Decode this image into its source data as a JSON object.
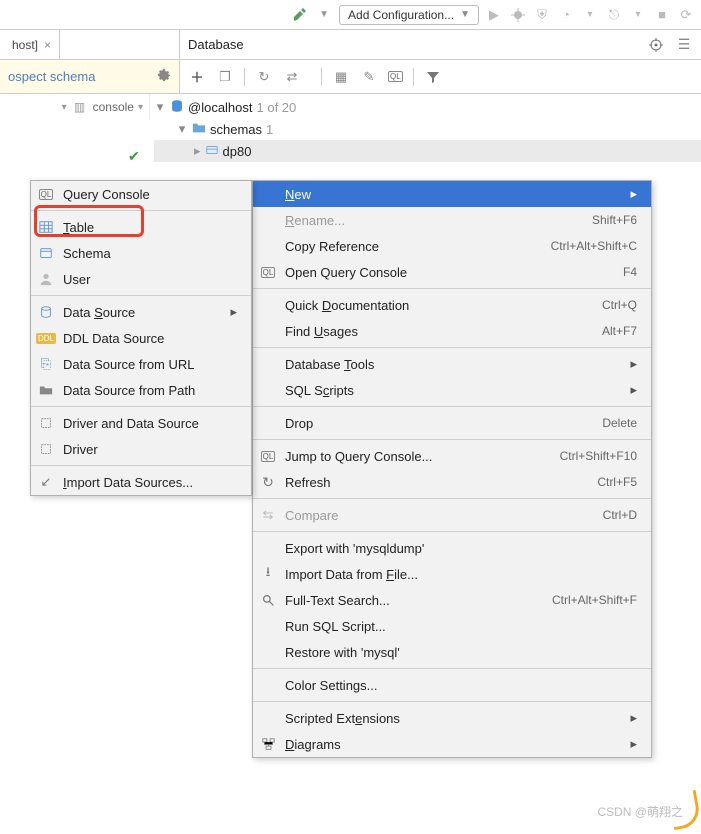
{
  "toolbar": {
    "add_config": "Add Configuration..."
  },
  "tab": {
    "title": "host]"
  },
  "panel": {
    "title": "Database"
  },
  "notice": {
    "text": "ospect schema"
  },
  "console": {
    "label": "console"
  },
  "tree": {
    "host": "@localhost",
    "host_count": "1 of 20",
    "schemas": "schemas",
    "schemas_count": "1",
    "db": "dp80"
  },
  "main_menu": [
    {
      "label": "New",
      "arrow": true,
      "sel": true,
      "u": 0
    },
    {
      "label": "Rename...",
      "sc": "Shift+F6",
      "u": 0,
      "dim": true
    },
    {
      "label": "Copy Reference",
      "sc": "Ctrl+Alt+Shift+C"
    },
    {
      "label": "Open Query Console",
      "sc": "F4",
      "icon": "ql"
    },
    {
      "sep": true
    },
    {
      "label": "Quick Documentation",
      "sc": "Ctrl+Q",
      "u": 6
    },
    {
      "label": "Find Usages",
      "sc": "Alt+F7",
      "u": 5
    },
    {
      "sep": true
    },
    {
      "label": "Database Tools",
      "arrow": true,
      "u": 9
    },
    {
      "label": "SQL Scripts",
      "arrow": true,
      "u": 5
    },
    {
      "sep": true
    },
    {
      "label": "Drop",
      "sc": "Delete"
    },
    {
      "sep": true
    },
    {
      "label": "Jump to Query Console...",
      "sc": "Ctrl+Shift+F10",
      "icon": "ql"
    },
    {
      "label": "Refresh",
      "sc": "Ctrl+F5",
      "icon": "refresh"
    },
    {
      "sep": true
    },
    {
      "label": "Compare",
      "sc": "Ctrl+D",
      "icon": "compare",
      "dim": true
    },
    {
      "sep": true
    },
    {
      "label": "Export with 'mysqldump'"
    },
    {
      "label": "Import Data from File...",
      "icon": "import",
      "u": 17
    },
    {
      "label": "Full-Text Search...",
      "sc": "Ctrl+Alt+Shift+F",
      "icon": "search"
    },
    {
      "label": "Run SQL Script..."
    },
    {
      "label": "Restore with 'mysql'"
    },
    {
      "sep": true
    },
    {
      "label": "Color Settings..."
    },
    {
      "sep": true
    },
    {
      "label": "Scripted Extensions",
      "arrow": true,
      "u": 12
    },
    {
      "label": "Diagrams",
      "arrow": true,
      "icon": "diagram",
      "u": 0
    }
  ],
  "sub_menu": [
    {
      "label": "Query Console",
      "icon": "ql"
    },
    {
      "sep": true
    },
    {
      "label": "Table",
      "icon": "table",
      "u": 0
    },
    {
      "label": "Schema",
      "icon": "schema"
    },
    {
      "label": "User",
      "icon": "user"
    },
    {
      "sep": true
    },
    {
      "label": "Data Source",
      "icon": "datasource",
      "arrow": true,
      "u": 5
    },
    {
      "label": "DDL Data Source",
      "icon": "ddl"
    },
    {
      "label": "Data Source from URL",
      "icon": "url"
    },
    {
      "label": "Data Source from Path",
      "icon": "path"
    },
    {
      "sep": true
    },
    {
      "label": "Driver and Data Source",
      "icon": "driver"
    },
    {
      "label": "Driver",
      "icon": "driver"
    },
    {
      "sep": true
    },
    {
      "label": "Import Data Sources...",
      "icon": "importds",
      "u": 0
    }
  ],
  "watermark": "CSDN @萌翔之"
}
